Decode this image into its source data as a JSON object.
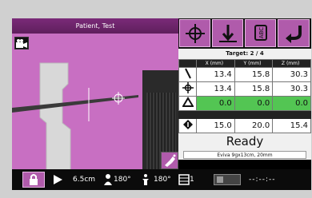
{
  "title": "Patient, Test",
  "target": "Target:  2 / 4",
  "table": {
    "headers": [
      "X (mm)",
      "Y (mm)",
      "Z (mm)"
    ],
    "rows": [
      {
        "icon": "needle-icon",
        "values": [
          "13.4",
          "15.8",
          "30.3"
        ],
        "highlight": false
      },
      {
        "icon": "crosshair-icon",
        "values": [
          "13.4",
          "15.8",
          "30.3"
        ],
        "highlight": false
      },
      {
        "icon": "delta-icon",
        "values": [
          "0.0",
          "0.0",
          "0.0"
        ],
        "highlight": true
      },
      {
        "icon": "diamond-target-icon",
        "values": [
          "15.0",
          "20.0",
          "15.4"
        ],
        "highlight": false
      }
    ]
  },
  "status": "Ready",
  "device": "Eviva 9gx13cm, 20mm",
  "bottom": {
    "depth": "6.5cm",
    "rotation1": "180°",
    "rotation2": "180°",
    "count": "1",
    "time": "--:--:--"
  },
  "colors": {
    "accent": "#b05bab",
    "ok": "#53c553",
    "viewport": "#c86fc2"
  }
}
